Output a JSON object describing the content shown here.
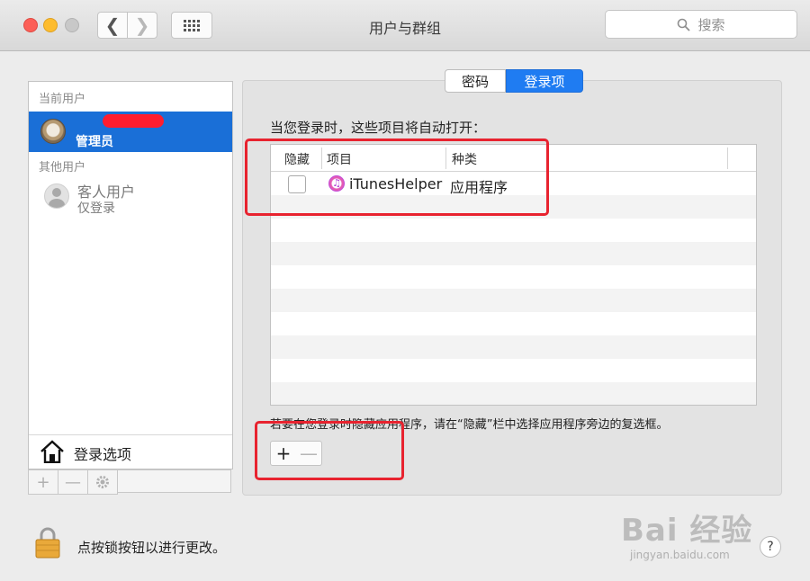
{
  "window": {
    "title": "用户与群组"
  },
  "toolbar": {
    "back_icon": "chevron-left-icon",
    "forward_icon": "chevron-right-icon",
    "grid_icon": "grid-icon",
    "search_placeholder": "搜索"
  },
  "sidebar": {
    "current_users_label": "当前用户",
    "current_user_role": "管理员",
    "other_users_label": "其他用户",
    "guest_name": "客人用户",
    "guest_subtitle": "仅登录",
    "login_options_label": "登录选项",
    "add_symbol": "+",
    "remove_symbol": "—",
    "gear_icon": "gear-icon"
  },
  "tabs": [
    {
      "label": "密码",
      "selected": false
    },
    {
      "label": "登录项",
      "selected": true
    }
  ],
  "main": {
    "heading": "当您登录时，这些项目将自动打开：",
    "columns": [
      "隐藏",
      "项目",
      "种类"
    ],
    "rows": [
      {
        "hidden": false,
        "item": "iTunesHelper",
        "kind": "应用程序"
      }
    ],
    "hint": "若要在您登录时隐藏应用程序，请在“隐藏”栏中选择应用程序旁边的复选框。",
    "add_symbol": "+",
    "remove_symbol": "—"
  },
  "footer": {
    "lock_label": "点按锁按钮以进行更改。",
    "help_symbol": "?"
  },
  "watermark": {
    "brand": "Bai 经验",
    "url": "jingyan.baidu.com"
  },
  "colors": {
    "accent": "#1f7cf2",
    "selection": "#1a6fd7",
    "annotation": "#e8232f"
  }
}
